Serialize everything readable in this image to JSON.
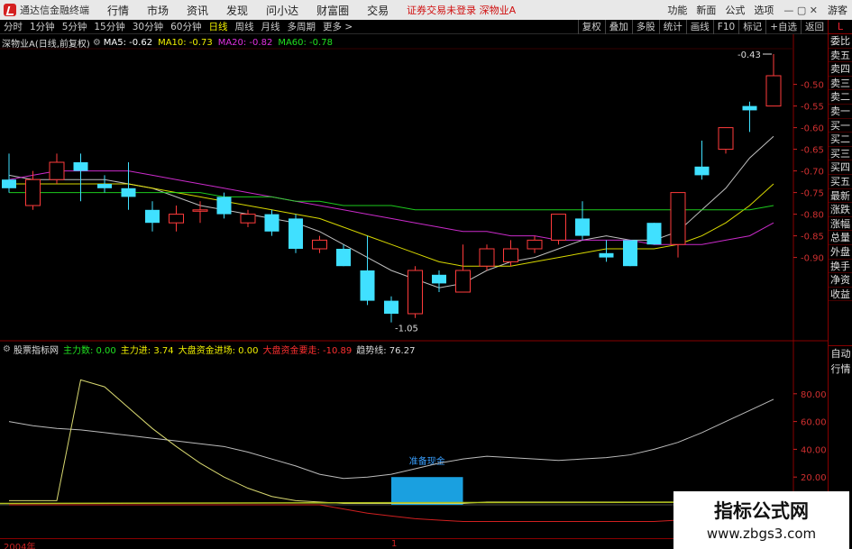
{
  "titlebar": {
    "app_name": "通达信金融终端",
    "menu": [
      "行情",
      "市场",
      "资讯",
      "发现",
      "问小达",
      "财富圈",
      "交易"
    ],
    "notice": "证券交易未登录  深物业A",
    "right_menu": [
      "功能",
      "新面",
      "公式",
      "选项",
      "游客"
    ]
  },
  "toolbar": {
    "periods": [
      "分时",
      "1分钟",
      "5分钟",
      "15分钟",
      "30分钟",
      "60分钟",
      "日线",
      "周线",
      "月线",
      "多周期",
      "更多 >"
    ],
    "active_period": "日线",
    "tools": [
      "复权",
      "叠加",
      "多股",
      "统计",
      "画线",
      "F10",
      "标记",
      "+自选",
      "返回"
    ]
  },
  "main_legend": {
    "title": "深物业A(日线,前复权)",
    "ma5": "MA5: -0.62",
    "ma10": "MA10: -0.73",
    "ma20": "MA20: -0.82",
    "ma60": "MA60: -0.78",
    "colors": {
      "ma5": "#ffffff",
      "ma10": "#f0f000",
      "ma20": "#e030e0",
      "ma60": "#20e020"
    }
  },
  "price_axis": [
    "-0.50",
    "-0.55",
    "-0.60",
    "-0.65",
    "-0.70",
    "-0.75",
    "-0.80",
    "-0.85",
    "-0.90"
  ],
  "annotations": {
    "high": "-0.43",
    "low": "-1.05"
  },
  "sub_legend": {
    "title": "股票指标网",
    "zl": "主力数: 0.00",
    "zlj": "主力进: 3.74",
    "dpzj": "大盘资金进场: 0.00",
    "dpzc": "大盘资金要走: -10.89",
    "qsx": "趋势线: 76.27"
  },
  "sub_axis": [
    "80.00",
    "60.00",
    "40.00",
    "20.00"
  ],
  "sub_label": "准备现金",
  "x_axis": [
    "2004年",
    "1"
  ],
  "right_panel": {
    "top": "L",
    "items": [
      "委比",
      "卖五",
      "卖四",
      "卖三",
      "卖二",
      "卖一",
      "买一",
      "买二",
      "买三",
      "买四",
      "买五",
      "最新",
      "涨跌",
      "涨幅",
      "总量",
      "外盘",
      "换手",
      "净资",
      "收益"
    ],
    "bottom": [
      "自动",
      "行情"
    ]
  },
  "watermark": {
    "line1": "指标公式网",
    "line2": "www.zbgs3.com"
  },
  "chart_data": [
    {
      "type": "candlestick",
      "title": "深物业A(日线,前复权)",
      "ylim": [
        -1.08,
        -0.43
      ],
      "candles": [
        {
          "o": -0.72,
          "c": -0.74,
          "h": -0.66,
          "l": -0.75
        },
        {
          "o": -0.78,
          "c": -0.72,
          "h": -0.7,
          "l": -0.79
        },
        {
          "o": -0.72,
          "c": -0.68,
          "h": -0.66,
          "l": -0.73
        },
        {
          "o": -0.68,
          "c": -0.7,
          "h": -0.66,
          "l": -0.77
        },
        {
          "o": -0.73,
          "c": -0.74,
          "h": -0.71,
          "l": -0.75
        },
        {
          "o": -0.74,
          "c": -0.76,
          "h": -0.68,
          "l": -0.79
        },
        {
          "o": -0.79,
          "c": -0.82,
          "h": -0.77,
          "l": -0.84
        },
        {
          "o": -0.82,
          "c": -0.8,
          "h": -0.78,
          "l": -0.84
        },
        {
          "o": -0.79,
          "c": -0.79,
          "h": -0.77,
          "l": -0.82
        },
        {
          "o": -0.76,
          "c": -0.8,
          "h": -0.75,
          "l": -0.81
        },
        {
          "o": -0.82,
          "c": -0.8,
          "h": -0.79,
          "l": -0.83
        },
        {
          "o": -0.8,
          "c": -0.84,
          "h": -0.79,
          "l": -0.85
        },
        {
          "o": -0.81,
          "c": -0.88,
          "h": -0.8,
          "l": -0.89
        },
        {
          "o": -0.88,
          "c": -0.86,
          "h": -0.85,
          "l": -0.89
        },
        {
          "o": -0.88,
          "c": -0.92,
          "h": -0.87,
          "l": -0.92
        },
        {
          "o": -0.93,
          "c": -1.0,
          "h": -0.85,
          "l": -1.01
        },
        {
          "o": -1.0,
          "c": -1.03,
          "h": -0.99,
          "l": -1.05
        },
        {
          "o": -1.03,
          "c": -0.93,
          "h": -0.92,
          "l": -1.04
        },
        {
          "o": -0.94,
          "c": -0.96,
          "h": -0.93,
          "l": -0.98
        },
        {
          "o": -0.98,
          "c": -0.93,
          "h": -0.87,
          "l": -0.98
        },
        {
          "o": -0.92,
          "c": -0.88,
          "h": -0.87,
          "l": -0.93
        },
        {
          "o": -0.91,
          "c": -0.88,
          "h": -0.86,
          "l": -0.92
        },
        {
          "o": -0.88,
          "c": -0.86,
          "h": -0.85,
          "l": -0.89
        },
        {
          "o": -0.86,
          "c": -0.8,
          "h": -0.8,
          "l": -0.87
        },
        {
          "o": -0.81,
          "c": -0.85,
          "h": -0.77,
          "l": -0.86
        },
        {
          "o": -0.89,
          "c": -0.9,
          "h": -0.86,
          "l": -0.91
        },
        {
          "o": -0.86,
          "c": -0.92,
          "h": -0.86,
          "l": -0.92
        },
        {
          "o": -0.82,
          "c": -0.87,
          "h": -0.82,
          "l": -0.87
        },
        {
          "o": -0.87,
          "c": -0.75,
          "h": -0.75,
          "l": -0.9
        },
        {
          "o": -0.69,
          "c": -0.71,
          "h": -0.63,
          "l": -0.72
        },
        {
          "o": -0.65,
          "c": -0.6,
          "h": -0.6,
          "l": -0.66
        },
        {
          "o": -0.55,
          "c": -0.56,
          "h": -0.54,
          "l": -0.61
        },
        {
          "o": -0.55,
          "c": -0.48,
          "h": -0.43,
          "l": -0.55
        }
      ],
      "series": [
        {
          "name": "MA5",
          "values": [
            -0.71,
            -0.72,
            -0.72,
            -0.72,
            -0.72,
            -0.73,
            -0.74,
            -0.76,
            -0.78,
            -0.79,
            -0.8,
            -0.81,
            -0.82,
            -0.84,
            -0.87,
            -0.9,
            -0.93,
            -0.95,
            -0.97,
            -0.96,
            -0.93,
            -0.91,
            -0.9,
            -0.88,
            -0.86,
            -0.85,
            -0.86,
            -0.86,
            -0.84,
            -0.79,
            -0.74,
            -0.67,
            -0.62
          ]
        },
        {
          "name": "MA10",
          "values": [
            -0.73,
            -0.73,
            -0.73,
            -0.73,
            -0.73,
            -0.73,
            -0.74,
            -0.75,
            -0.76,
            -0.77,
            -0.78,
            -0.79,
            -0.8,
            -0.81,
            -0.83,
            -0.85,
            -0.87,
            -0.89,
            -0.91,
            -0.92,
            -0.92,
            -0.92,
            -0.91,
            -0.9,
            -0.89,
            -0.88,
            -0.88,
            -0.88,
            -0.87,
            -0.85,
            -0.82,
            -0.78,
            -0.73
          ]
        },
        {
          "name": "MA20",
          "values": [
            -0.72,
            -0.71,
            -0.7,
            -0.7,
            -0.7,
            -0.7,
            -0.71,
            -0.72,
            -0.73,
            -0.74,
            -0.75,
            -0.76,
            -0.77,
            -0.78,
            -0.79,
            -0.8,
            -0.81,
            -0.82,
            -0.83,
            -0.84,
            -0.84,
            -0.85,
            -0.85,
            -0.86,
            -0.86,
            -0.86,
            -0.86,
            -0.87,
            -0.87,
            -0.87,
            -0.86,
            -0.85,
            -0.82
          ]
        },
        {
          "name": "MA60",
          "values": [
            -0.75,
            -0.75,
            -0.75,
            -0.75,
            -0.75,
            -0.75,
            -0.75,
            -0.75,
            -0.75,
            -0.76,
            -0.76,
            -0.76,
            -0.77,
            -0.77,
            -0.78,
            -0.78,
            -0.78,
            -0.79,
            -0.79,
            -0.79,
            -0.79,
            -0.79,
            -0.79,
            -0.79,
            -0.79,
            -0.79,
            -0.79,
            -0.79,
            -0.79,
            -0.79,
            -0.79,
            -0.79,
            -0.78
          ]
        }
      ]
    },
    {
      "type": "line",
      "title": "股票指标网",
      "ylim": [
        0,
        100
      ],
      "series": [
        {
          "name": "趋势线",
          "values": [
            60,
            57,
            55,
            54,
            52,
            50,
            48,
            46,
            44,
            42,
            38,
            33,
            28,
            22,
            19,
            20,
            22,
            26,
            30,
            33,
            35,
            34,
            33,
            32,
            33,
            34,
            36,
            40,
            45,
            52,
            60,
            68,
            76
          ]
        },
        {
          "name": "主力进",
          "values": [
            3,
            3,
            3,
            90,
            85,
            70,
            55,
            42,
            30,
            20,
            12,
            6,
            3,
            2,
            1,
            1,
            1,
            1,
            1,
            1,
            2,
            2,
            2,
            2,
            2,
            2,
            2,
            2,
            2,
            2,
            2,
            3,
            3
          ]
        },
        {
          "name": "大盘资金要走",
          "values": [
            0,
            0,
            0,
            0,
            0,
            0,
            0,
            0,
            0,
            0,
            0,
            0,
            0,
            0,
            -3,
            -6,
            -8,
            -10,
            -11,
            -12,
            -12,
            -12,
            -12,
            -12,
            -12,
            -12,
            -12,
            -12,
            -11,
            -11,
            -11,
            -11,
            -11
          ]
        }
      ],
      "bar": {
        "label": "准备现金",
        "from": 16,
        "to": 19,
        "value": 20
      }
    }
  ]
}
